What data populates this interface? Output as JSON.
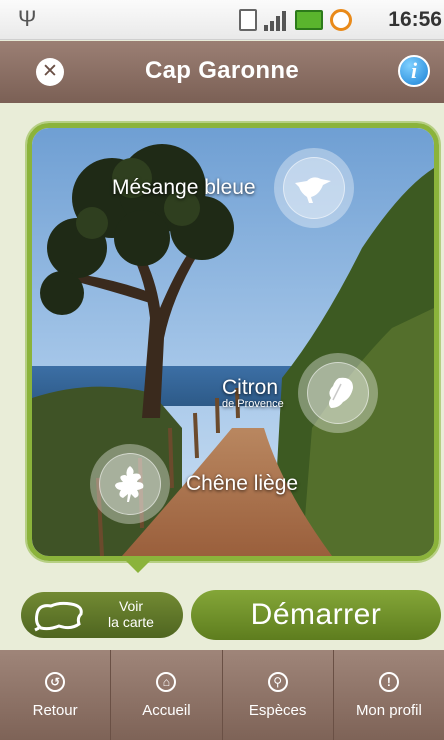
{
  "status_bar": {
    "time": "16:56"
  },
  "header": {
    "title": "Cap Garonne",
    "close_icon": "close-icon",
    "info_icon": "info-icon"
  },
  "hotspots": [
    {
      "label": "Mésange bleue",
      "icon": "bird-icon"
    },
    {
      "label": "Citron",
      "sublabel": "de Provence",
      "icon": "butterfly-icon"
    },
    {
      "label": "Chêne liège",
      "icon": "oak-leaf-icon"
    }
  ],
  "actions": {
    "map_line1": "Voir",
    "map_line2": "la carte",
    "start_label": "Démarrer"
  },
  "tabs": [
    {
      "label": "Retour",
      "icon": "back-icon"
    },
    {
      "label": "Accueil",
      "icon": "home-icon"
    },
    {
      "label": "Espèces",
      "icon": "species-icon"
    },
    {
      "label": "Mon profil",
      "icon": "profile-icon"
    }
  ],
  "colors": {
    "accent_green": "#8bb33b",
    "header_brown": "#8a6e63"
  }
}
